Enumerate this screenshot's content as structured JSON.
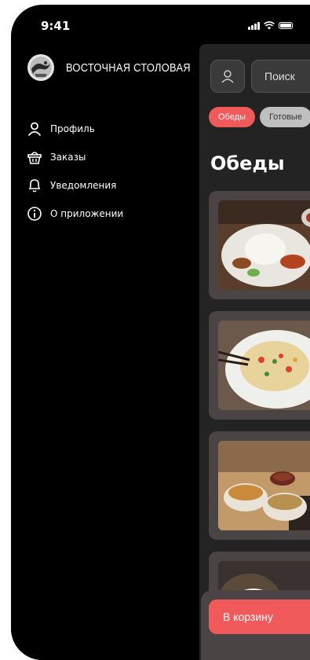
{
  "status_bar": {
    "time": "9:41"
  },
  "drawer": {
    "brand_name": "ВОСТОЧНАЯ СТОЛОВАЯ",
    "menu": [
      {
        "label": "Профиль",
        "icon": "user-icon"
      },
      {
        "label": "Заказы",
        "icon": "basket-icon"
      },
      {
        "label": "Уведомления",
        "icon": "bell-icon"
      },
      {
        "label": "О приложении",
        "icon": "info-icon"
      }
    ]
  },
  "main": {
    "search_label": "Поиск",
    "categories": [
      {
        "label": "Обеды",
        "active": true
      },
      {
        "label": "Готовые",
        "active": false
      }
    ],
    "section_title": "Обеды",
    "dishes": [
      {
        "photo": "rice-plate-photo"
      },
      {
        "photo": "noodle-salad-photo"
      },
      {
        "photo": "donburi-bowls-photo"
      },
      {
        "photo": "egg-dish-photo"
      }
    ],
    "cart_button": "В корзину"
  },
  "colors": {
    "accent": "#f05a5a",
    "background": "#000000",
    "surface": "#232323",
    "card": "#4a4444",
    "chip_idle": "#bfbfbf"
  }
}
